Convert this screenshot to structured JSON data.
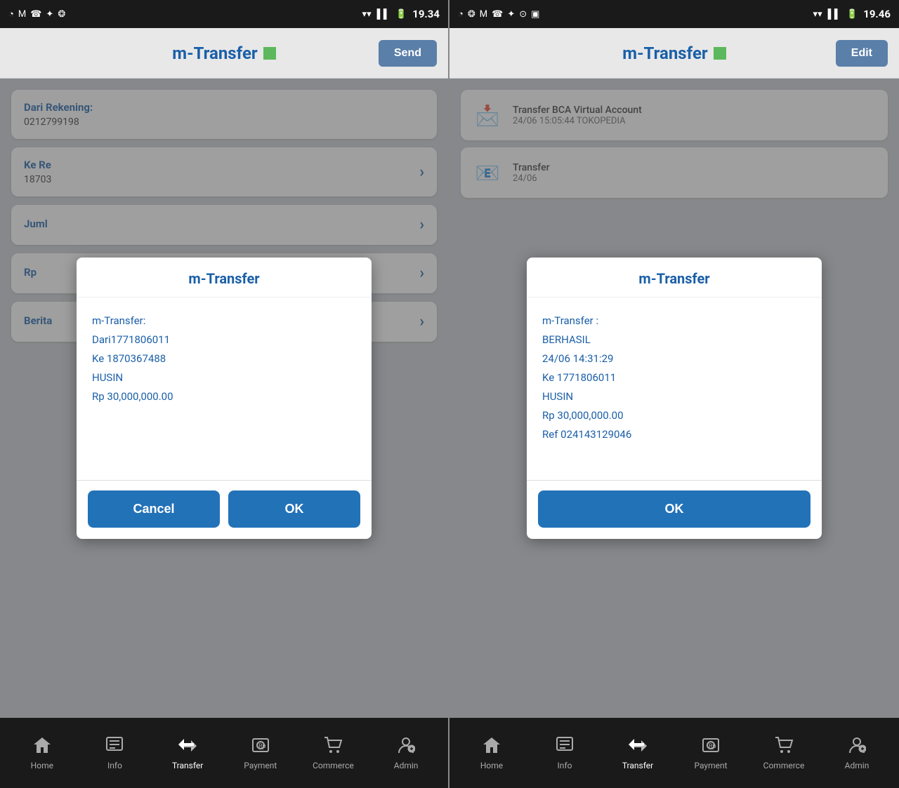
{
  "left_panel": {
    "status_bar": {
      "time": "19.34",
      "icons": "◎ M ☎ ✦ ❂"
    },
    "top_bar": {
      "title": "m-Transfer",
      "action_btn": "Send"
    },
    "form": {
      "dari_label": "Dari Rekening:",
      "dari_value": "0212799198",
      "ke_label": "Ke Re",
      "ke_value": "18703",
      "jumlah_label": "Juml",
      "rp_label": "Rp",
      "berita_label": "Berita"
    },
    "dialog": {
      "title": "m-Transfer",
      "body_line1": "m-Transfer:",
      "body_line2": "Dari1771806011",
      "body_line3": "Ke 1870367488",
      "body_line4": "HUSIN",
      "body_line5": "Rp 30,000,000.00",
      "cancel_btn": "Cancel",
      "ok_btn": "OK"
    },
    "bottom_nav": [
      {
        "label": "Home",
        "icon": "home",
        "active": false
      },
      {
        "label": "Info",
        "icon": "info",
        "active": false
      },
      {
        "label": "Transfer",
        "icon": "transfer",
        "active": true
      },
      {
        "label": "Payment",
        "icon": "payment",
        "active": false
      },
      {
        "label": "Commerce",
        "icon": "commerce",
        "active": false
      },
      {
        "label": "Admin",
        "icon": "admin",
        "active": false
      }
    ]
  },
  "right_panel": {
    "status_bar": {
      "time": "19.46",
      "icons": "◎ ❂ M ☎ ✦ ⊙ ▣"
    },
    "top_bar": {
      "title": "m-Transfer",
      "action_btn": "Edit"
    },
    "inbox": [
      {
        "icon": "📩",
        "title": "Transfer BCA Virtual Account",
        "subtitle": "24/06 15:05:44 TOKOPEDIA"
      },
      {
        "icon": "📧",
        "title": "Transfer",
        "subtitle": "24/06"
      }
    ],
    "dialog": {
      "title": "m-Transfer",
      "body_line1": "m-Transfer :",
      "body_line2": "BERHASIL",
      "body_line3": "24/06 14:31:29",
      "body_line4": "Ke 1771806011",
      "body_line5": "HUSIN",
      "body_line6": "Rp 30,000,000.00",
      "body_line7": "Ref 024143129046",
      "ok_btn": "OK"
    },
    "bottom_nav": [
      {
        "label": "Home",
        "icon": "home",
        "active": false
      },
      {
        "label": "Info",
        "icon": "info",
        "active": false
      },
      {
        "label": "Transfer",
        "icon": "transfer",
        "active": true
      },
      {
        "label": "Payment",
        "icon": "payment",
        "active": false
      },
      {
        "label": "Commerce",
        "icon": "commerce",
        "active": false
      },
      {
        "label": "Admin",
        "icon": "admin",
        "active": false
      }
    ]
  }
}
